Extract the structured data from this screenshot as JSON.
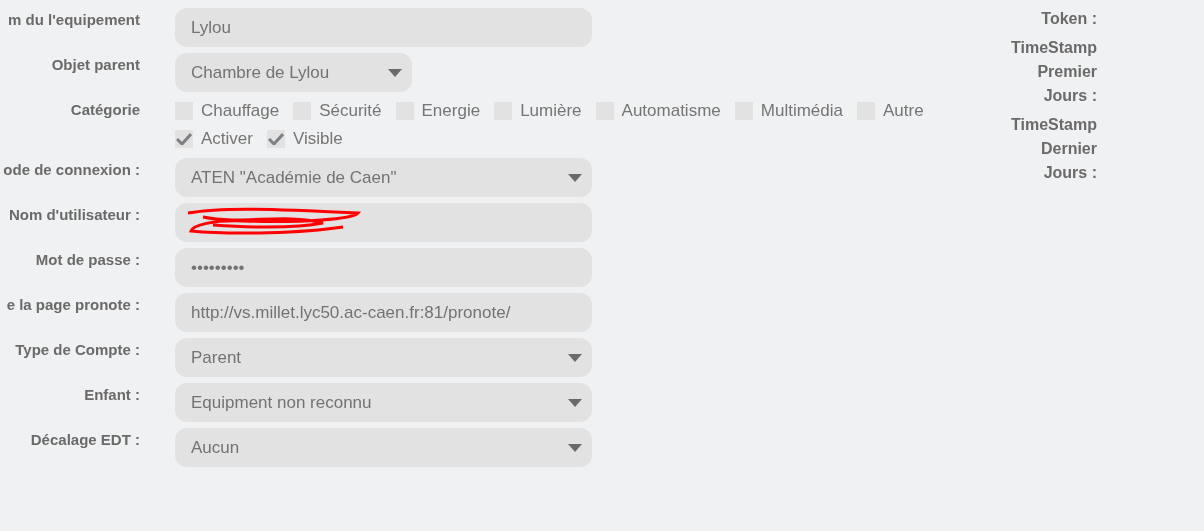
{
  "form": [
    {
      "kind": "text",
      "label": "m du l'equipement",
      "value": "Lylou"
    },
    {
      "kind": "select",
      "label": "Objet parent",
      "value": "Chambre de Lylou",
      "narrow": true
    },
    {
      "kind": "checks",
      "label": "Catégorie",
      "options": [
        {
          "label": "Chauffage",
          "checked": false
        },
        {
          "label": "Sécurité",
          "checked": false
        },
        {
          "label": "Energie",
          "checked": false
        },
        {
          "label": "Lumière",
          "checked": false
        },
        {
          "label": "Automatisme",
          "checked": false
        },
        {
          "label": "Multimédia",
          "checked": false
        },
        {
          "label": "Autre",
          "checked": false
        }
      ]
    },
    {
      "kind": "checks",
      "options": [
        {
          "label": "Activer",
          "checked": true
        },
        {
          "label": "Visible",
          "checked": true
        }
      ]
    },
    {
      "kind": "select",
      "label": "ode de connexion :",
      "value": "ATEN \"Académie de Caen\""
    },
    {
      "kind": "text",
      "label": "Nom d'utilisateur :",
      "redacted": true
    },
    {
      "kind": "text",
      "label": "Mot de passe :",
      "value": "•••••••••"
    },
    {
      "kind": "text",
      "label": "e la page pronote :",
      "value": "http://vs.millet.lyc50.ac-caen.fr:81/pronote/"
    },
    {
      "kind": "select",
      "label": "Type de Compte :",
      "value": "Parent"
    },
    {
      "kind": "select",
      "label": "Enfant :",
      "value": "Equipment non reconnu"
    },
    {
      "kind": "select",
      "label": "Décalage EDT :",
      "value": "Aucun"
    }
  ],
  "info": [
    {
      "label": "Token :"
    },
    {
      "label": "TimeStamp Premier Jours :"
    },
    {
      "label": "TimeStamp Dernier Jours :"
    }
  ]
}
